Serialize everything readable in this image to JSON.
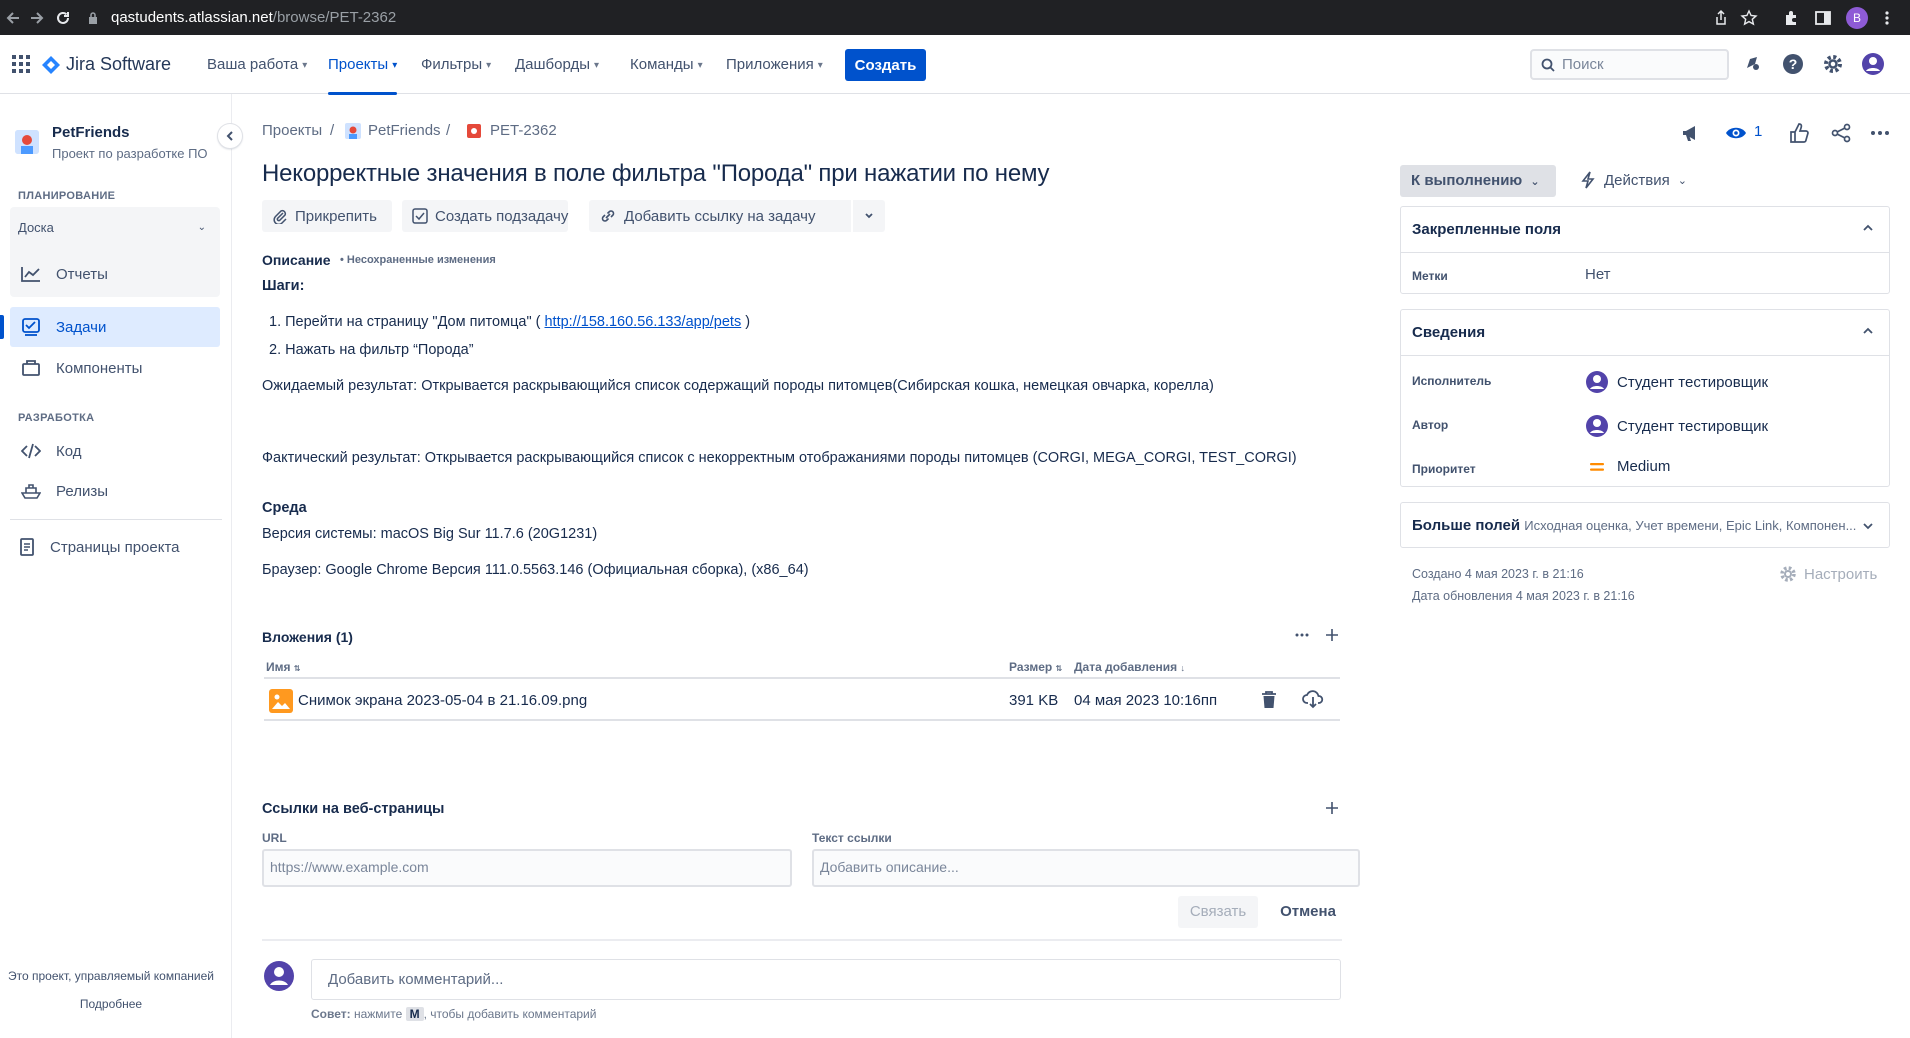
{
  "browser": {
    "url_host": "qastudents.atlassian.net",
    "url_path": "/browse/PET-2362",
    "profile_initial": "B"
  },
  "topnav": {
    "product": "Jira Software",
    "items": [
      {
        "label": "Ваша работа",
        "active": false
      },
      {
        "label": "Проекты",
        "active": true
      },
      {
        "label": "Фильтры",
        "active": false
      },
      {
        "label": "Дашборды",
        "active": false
      },
      {
        "label": "Команды",
        "active": false
      },
      {
        "label": "Приложения",
        "active": false
      }
    ],
    "create_label": "Создать",
    "search_placeholder": "Поиск"
  },
  "sidebar": {
    "project_name": "PetFriends",
    "project_sub": "Проект по разработке ПО",
    "planning_header": "ПЛАНИРОВАНИЕ",
    "board_label": "Доска",
    "reports_label": "Отчеты",
    "issues_label": "Задачи",
    "components_label": "Компоненты",
    "dev_header": "РАЗРАБОТКА",
    "code_label": "Код",
    "releases_label": "Релизы",
    "pages_label": "Страницы проекта",
    "footer_text": "Это проект, управляемый компанией",
    "footer_link": "Подробнее"
  },
  "breadcrumbs": [
    "Проекты",
    "PetFriends",
    "PET-2362"
  ],
  "issue": {
    "title": "Некорректные значения в поле фильтра \"Порода\" при нажатии по нему",
    "buttons": {
      "attach": "Прикрепить",
      "subtask": "Создать подзадачу",
      "link": "Добавить ссылку на задачу"
    },
    "description_label": "Описание",
    "unsaved_label": "• Несохраненные изменения",
    "steps_label": "Шаги:",
    "step1_prefix": "1. Перейти на страницу \"Дом питомца\" ( ",
    "step1_link": "http://158.160.56.133/app/pets",
    "step1_suffix": " )",
    "step2": "2. Нажать на фильтр “Порода”",
    "expected": "Ожидаемый результат: Открывается раскрывающийся список содержащий породы питомцев(Сибирская кошка, немецкая овчарка, корелла)",
    "actual": "Фактический результат: Открывается раскрывающийся список с некорректным отображаниями породы питомцев (CORGI, MEGA_CORGI, TEST_CORGI)",
    "env_label": "Среда",
    "os_version": "Версия системы: macOS Big Sur 11.7.6 (20G1231)",
    "browser_version": "Браузер: Google Chrome Версия 111.0.5563.146 (Официальная сборка), (x86_64)"
  },
  "attachments": {
    "header": "Вложения (1)",
    "col_name": "Имя",
    "col_size": "Размер",
    "col_date": "Дата добавления",
    "rows": [
      {
        "name": "Снимок экрана 2023-05-04 в 21.16.09.png",
        "size": "391 KB",
        "date": "04 мая 2023 10:16пп"
      }
    ]
  },
  "weblinks": {
    "header": "Ссылки на веб-страницы",
    "url_label": "URL",
    "url_placeholder": "https://www.example.com",
    "text_label": "Текст ссылки",
    "text_placeholder": "Добавить описание...",
    "link_button": "Связать",
    "cancel_button": "Отмена"
  },
  "comment": {
    "placeholder": "Добавить комментарий...",
    "tip_prefix": "Совет:",
    "tip_middle": " нажмите ",
    "tip_key": "M",
    "tip_suffix": ", чтобы добавить комментарий"
  },
  "right": {
    "watchers": "1",
    "status": "К выполнению",
    "actions": "Действия",
    "pinned_header": "Закрепленные поля",
    "labels_label": "Метки",
    "labels_value": "Нет",
    "details_header": "Сведения",
    "assignee_label": "Исполнитель",
    "assignee_value": "Студент тестировщик",
    "reporter_label": "Автор",
    "reporter_value": "Студент тестировщик",
    "priority_label": "Приоритет",
    "priority_value": "Medium",
    "more_label": "Больше полей",
    "more_fields": "Исходная оценка, Учет времени, Epic Link, Компонен...",
    "created": "Создано 4 мая 2023 г. в 21:16",
    "updated": "Дата обновления 4 мая 2023 г. в 21:16",
    "configure": "Настроить"
  },
  "colors": {
    "accent": "#0052cc",
    "priority_medium": "#ff8b00",
    "attachment_icon": "#ff991f",
    "issue_type_bug": "#e5493a"
  }
}
